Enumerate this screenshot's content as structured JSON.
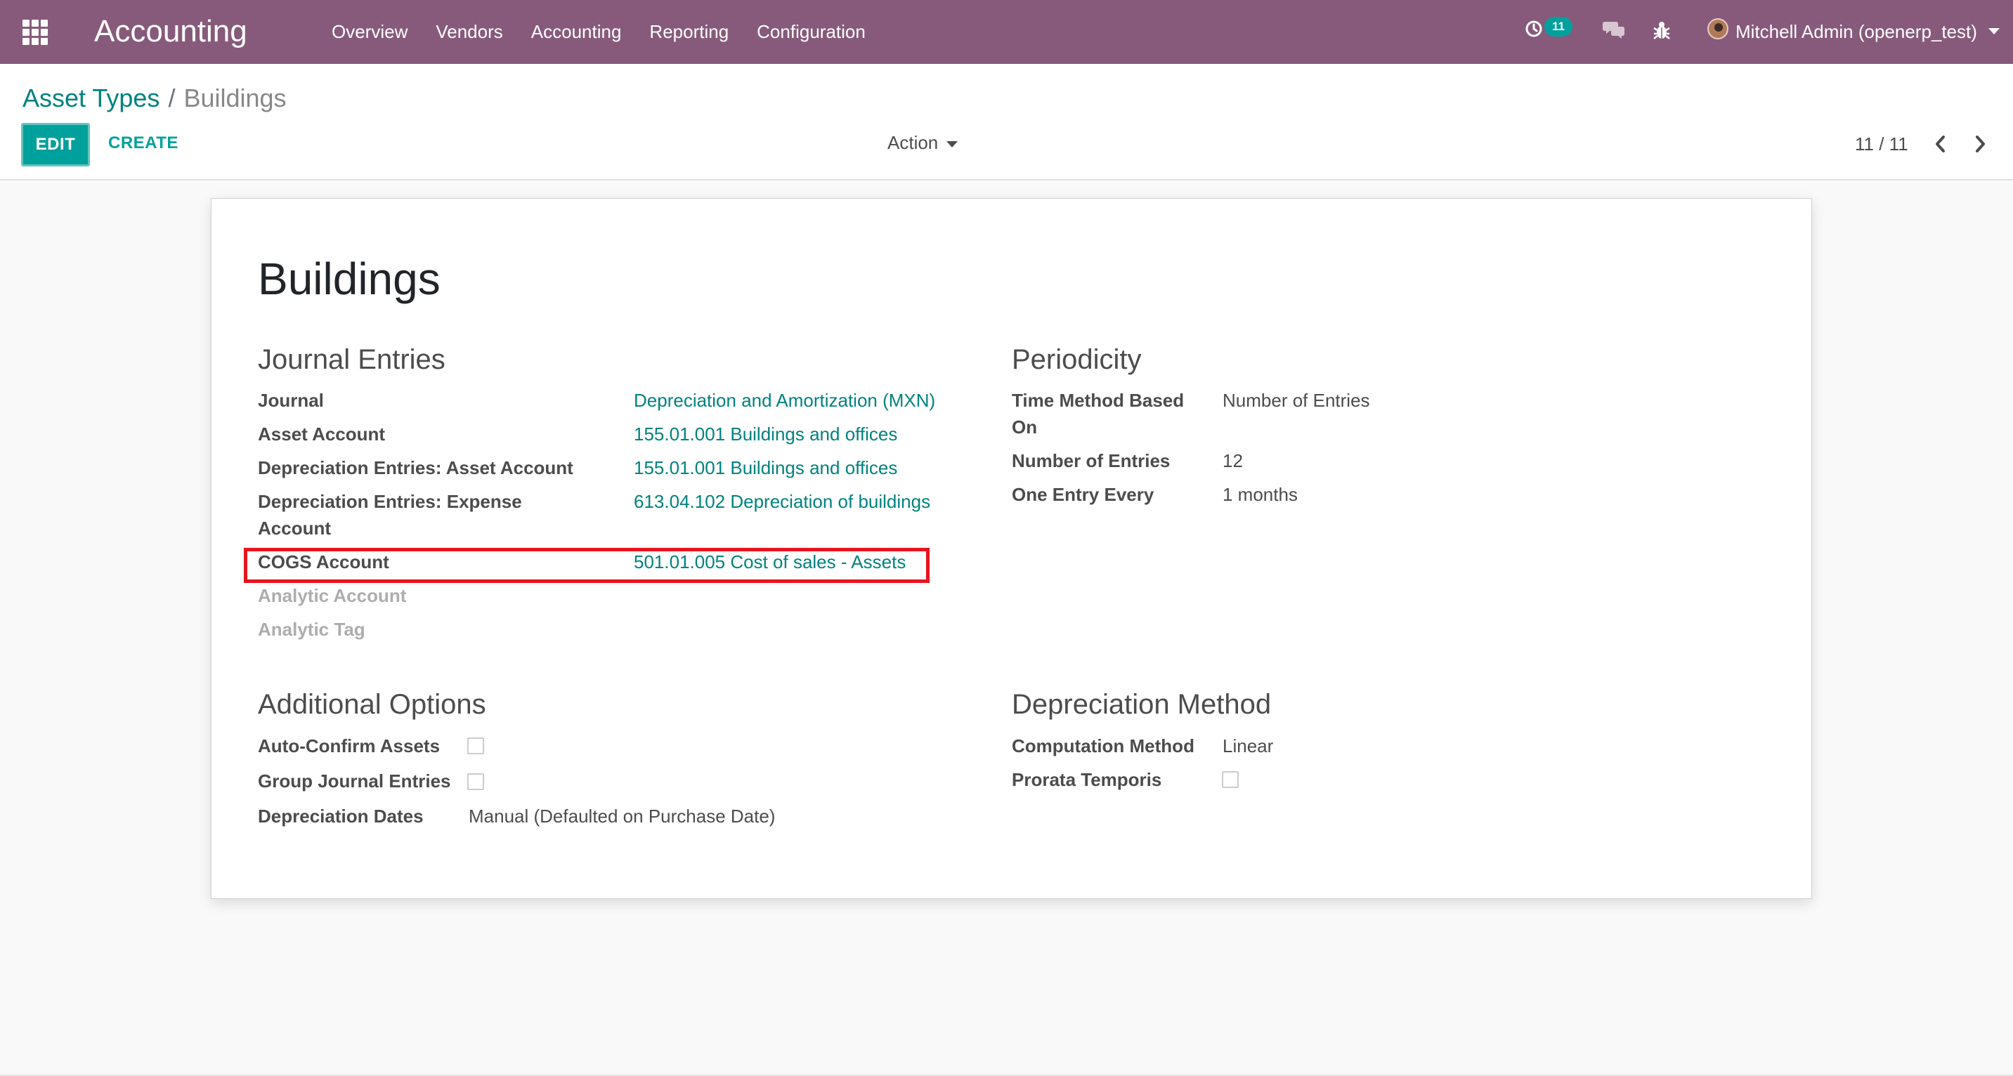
{
  "navbar": {
    "brand": "Accounting",
    "menu": [
      "Overview",
      "Vendors",
      "Accounting",
      "Reporting",
      "Configuration"
    ],
    "activity_count": "11",
    "user": "Mitchell Admin (openerp_test)"
  },
  "breadcrumb": {
    "parent": "Asset Types",
    "separator": "/",
    "current": "Buildings"
  },
  "controls": {
    "edit": "EDIT",
    "create": "CREATE",
    "action": "Action",
    "pager": "11 / 11"
  },
  "record": {
    "name": "Buildings",
    "journal_entries": {
      "title": "Journal Entries",
      "fields": [
        {
          "label": "Journal",
          "value": "Depreciation and Amortization (MXN)"
        },
        {
          "label": "Asset Account",
          "value": "155.01.001 Buildings and offices"
        },
        {
          "label": "Depreciation Entries: Asset Account",
          "value": "155.01.001 Buildings and offices"
        },
        {
          "label_line1": "Depreciation Entries: Expense",
          "label_line2": "Account",
          "value": "613.04.102 Depreciation of buildings"
        },
        {
          "label": "COGS Account",
          "value": "501.01.005 Cost of sales - Assets"
        },
        {
          "label": "Analytic Account",
          "value": ""
        },
        {
          "label": "Analytic Tag",
          "value": ""
        }
      ]
    },
    "periodicity": {
      "title": "Periodicity",
      "fields": [
        {
          "label_line1": "Time Method Based",
          "label_line2": "On",
          "value": "Number of Entries"
        },
        {
          "label": "Number of Entries",
          "value": "12"
        },
        {
          "label": "One Entry Every",
          "value": "1 months"
        }
      ]
    },
    "additional_options": {
      "title": "Additional Options",
      "fields": [
        {
          "label": "Auto-Confirm Assets",
          "checked": false
        },
        {
          "label": "Group Journal Entries",
          "checked": false
        },
        {
          "label": "Depreciation Dates",
          "value": "Manual (Defaulted on Purchase Date)"
        }
      ]
    },
    "depreciation_method": {
      "title": "Depreciation Method",
      "fields": [
        {
          "label": "Computation Method",
          "value": "Linear"
        },
        {
          "label": "Prorata Temporis",
          "checked": false
        }
      ]
    }
  },
  "colors": {
    "navbar": "#875a7b",
    "primary": "#00a09d",
    "link": "#00827f",
    "highlight": "#e8141e"
  }
}
